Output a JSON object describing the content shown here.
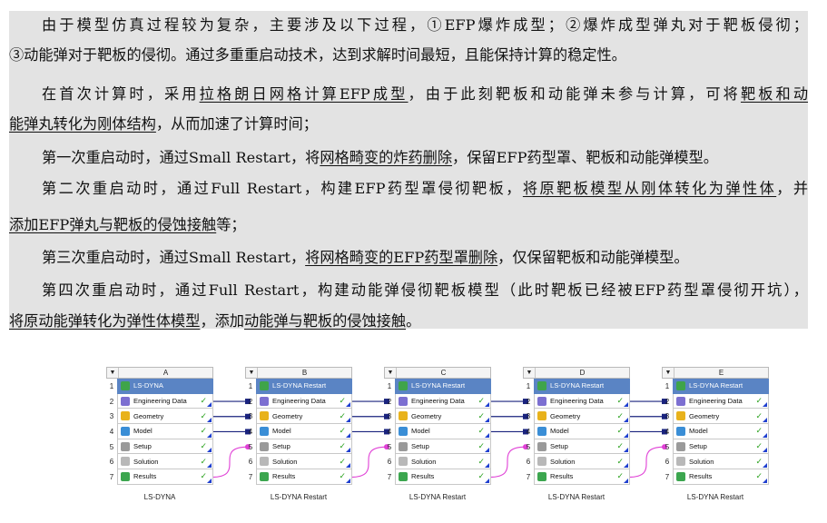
{
  "paragraphs": [
    {
      "segments": [
        {
          "text": "由于模型仿真过程较为复杂，主要涉及以下过程，①EFP爆炸成型；②爆炸成型弹丸对于靶板侵彻；",
          "u": false
        }
      ]
    },
    {
      "segments": [
        {
          "text": "③动能弹对于靶板的侵彻。通过多重重启动技术，达到求解时间最短，且能保持计算的稳定性。",
          "u": false
        }
      ]
    },
    {
      "segments": [
        {
          "text": "在首次计算时，采用",
          "u": false
        },
        {
          "text": "拉格朗日网格计算EFP成型",
          "u": true
        },
        {
          "text": "，由于此刻靶板和动能弹未参与计算，可将",
          "u": false
        },
        {
          "text": "靶板和动",
          "u": true
        }
      ]
    },
    {
      "segments": [
        {
          "text": "能弹丸转化为刚体结构",
          "u": true
        },
        {
          "text": "，从而加速了计算时间；",
          "u": false
        }
      ]
    },
    {
      "segments": [
        {
          "text": "第一次重启动时，通过Small Restart，将",
          "u": false
        },
        {
          "text": "网格畸变的炸药删除",
          "u": true
        },
        {
          "text": "，保留EFP药型罩、靶板和动能弹模型。",
          "u": false
        }
      ]
    },
    {
      "segments": [
        {
          "text": "第二次重启动时，通过Full Restart，构建EFP药型罩侵彻靶板，",
          "u": false
        },
        {
          "text": "将原靶板模型从刚体转化为弹性体",
          "u": true
        },
        {
          "text": "，并",
          "u": false
        }
      ]
    },
    {
      "segments": [
        {
          "text": "添加EFP弹丸与靶板的侵蚀接触",
          "u": true
        },
        {
          "text": "等；",
          "u": false
        }
      ]
    },
    {
      "segments": [
        {
          "text": "第三次重启动时，通过Small Restart，",
          "u": false
        },
        {
          "text": "将网格畸变的EFP药型罩删除",
          "u": true
        },
        {
          "text": "，仅保留靶板和动能弹模型。",
          "u": false
        }
      ]
    },
    {
      "segments": [
        {
          "text": "第四次重启动时，通过Full Restart，构建动能弹侵彻靶板模型（此时靶板已经被EFP药型罩侵彻开坑），",
          "u": false
        }
      ]
    },
    {
      "segments": [
        {
          "text": "将原动能弹转化为弹性体模型",
          "u": true
        },
        {
          "text": "，添加",
          "u": false
        },
        {
          "text": "动能弹与靶板的侵蚀接触",
          "u": true
        },
        {
          "text": "。",
          "u": false
        }
      ]
    }
  ],
  "systems": [
    {
      "letter": "A",
      "title": "LS-DYNA",
      "label": "LS-DYNA"
    },
    {
      "letter": "B",
      "title": "LS-DYNA Restart",
      "label": "LS-DYNA Restart"
    },
    {
      "letter": "C",
      "title": "LS-DYNA Restart",
      "label": "LS-DYNA Restart"
    },
    {
      "letter": "D",
      "title": "LS-DYNA Restart",
      "label": "LS-DYNA Restart"
    },
    {
      "letter": "E",
      "title": "LS-DYNA Restart",
      "label": "LS-DYNA Restart"
    }
  ],
  "rows": [
    {
      "num": "1",
      "icon": "ls-dyna-icon",
      "color": "#3fa44a"
    },
    {
      "num": "2",
      "icon": "engineering-data-icon",
      "color": "#7c6fd1",
      "label": "Engineering Data"
    },
    {
      "num": "3",
      "icon": "geometry-icon",
      "color": "#e8b21c",
      "label": "Geometry"
    },
    {
      "num": "4",
      "icon": "model-icon",
      "color": "#3a8ed6",
      "label": "Model"
    },
    {
      "num": "5",
      "icon": "setup-icon",
      "color": "#9a9a9a",
      "label": "Setup"
    },
    {
      "num": "6",
      "icon": "solution-icon",
      "color": "#b8b8b8",
      "label": "Solution"
    },
    {
      "num": "7",
      "icon": "results-icon",
      "color": "#3ca64f",
      "label": "Results"
    }
  ],
  "check_glyph": "✓",
  "collapse_glyph": "▼",
  "link_colors": {
    "data_link": "#1a237e",
    "restart_link": "#e040d6"
  }
}
